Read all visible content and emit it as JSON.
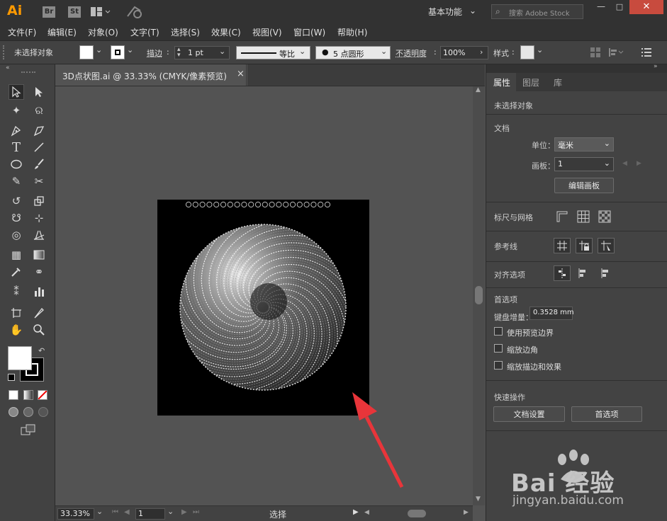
{
  "app": {
    "logo": "Ai",
    "bridge": "Br",
    "stock": "St"
  },
  "workspace": {
    "label": "基本功能"
  },
  "search": {
    "placeholder": "搜索 Adobe Stock"
  },
  "menu": [
    "文件(F)",
    "编辑(E)",
    "对象(O)",
    "文字(T)",
    "选择(S)",
    "效果(C)",
    "视图(V)",
    "窗口(W)",
    "帮助(H)"
  ],
  "control": {
    "selection": "未选择对象",
    "stroke_label": "描边",
    "stroke_weight": "1 pt",
    "profile": "等比",
    "brush": "5 点圆形",
    "opacity_label": "不透明度",
    "opacity_value": "100%",
    "style_label": "样式"
  },
  "document": {
    "tab_title": "3D点状图.ai @ 33.33% (CMYK/像素预览)",
    "close": "×"
  },
  "status": {
    "zoom": "33.33%",
    "artboard": "1",
    "tool": "选择"
  },
  "panel": {
    "tabs": [
      "属性",
      "图层",
      "库"
    ],
    "no_selection": "未选择对象",
    "document_title": "文档",
    "units_label": "单位：",
    "units_value": "毫米",
    "artboard_label": "画板：",
    "artboard_value": "1",
    "edit_artboards": "编辑画板",
    "rulers_grids": "标尺与网格",
    "guides": "参考线",
    "align_options": "对齐选项",
    "preferences": "首选项",
    "keyboard_increment_label": "键盘增量：",
    "keyboard_increment_value": "0.3528 mm",
    "use_preview_bounds": "使用预览边界",
    "scale_corners": "缩放边角",
    "scale_strokes": "缩放描边和效果",
    "quick_actions": "快速操作",
    "document_setup": "文档设置",
    "preferences_btn": "首选项"
  },
  "watermark": {
    "brand": "Bai 经验",
    "url": "jingyan.baidu.com"
  },
  "colors": {
    "accent_arrow": "#e8353a",
    "chrome": "#323232",
    "panel": "#434343",
    "canvas": "#535353"
  }
}
